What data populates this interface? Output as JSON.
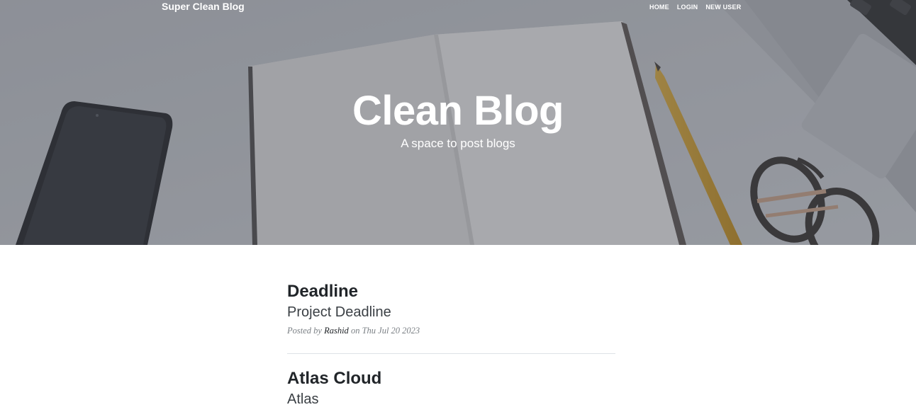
{
  "navbar": {
    "brand": "Super Clean Blog",
    "links": [
      {
        "label": "HOME"
      },
      {
        "label": "LOGIN"
      },
      {
        "label": "NEW USER"
      }
    ]
  },
  "hero": {
    "title": "Clean Blog",
    "subtitle": "A space to post blogs"
  },
  "posts": [
    {
      "title": "Deadline",
      "subtitle": "Project Deadline",
      "meta_prefix": "Posted by",
      "author": "Rashid",
      "meta_middle": "on",
      "date": "Thu Jul 20 2023"
    },
    {
      "title": "Atlas Cloud",
      "subtitle": "Atlas"
    }
  ],
  "colors": {
    "overlay": "#464a52",
    "text_dark": "#212529",
    "meta": "#7b8085",
    "divider": "#dee2e6"
  }
}
